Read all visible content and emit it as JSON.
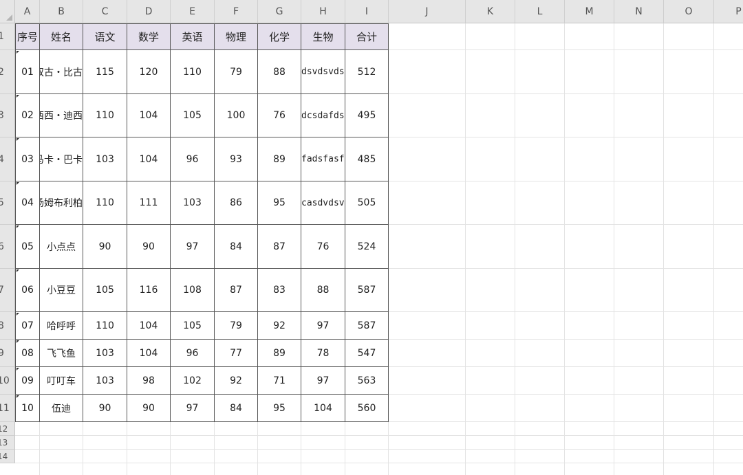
{
  "columns": [
    "A",
    "B",
    "C",
    "D",
    "E",
    "F",
    "G",
    "H",
    "I",
    "J",
    "K",
    "L",
    "M",
    "N",
    "O",
    "P"
  ],
  "row_numbers": [
    "1",
    "2",
    "3",
    "4",
    "5",
    "6",
    "7",
    "8",
    "9",
    "10",
    "11",
    "12",
    "13",
    "14"
  ],
  "table": {
    "headers": [
      "序号",
      "姓名",
      "语文",
      "数学",
      "英语",
      "物理",
      "化学",
      "生物",
      "合计"
    ],
    "rows": [
      [
        "01",
        "奴古・比古",
        "115",
        "120",
        "110",
        "79",
        "88",
        "dsvdsvdsv",
        "512"
      ],
      [
        "02",
        "西西・迪西",
        "110",
        "104",
        "105",
        "100",
        "76",
        "dcsdafdsf",
        "495"
      ],
      [
        "03",
        "马卡・巴卡",
        "103",
        "104",
        "96",
        "93",
        "89",
        "fadsfasfd",
        "485"
      ],
      [
        "04",
        "汤姆布利柏",
        "110",
        "111",
        "103",
        "86",
        "95",
        "casdvdsvs",
        "505"
      ],
      [
        "05",
        "小点点",
        "90",
        "90",
        "97",
        "84",
        "87",
        "76",
        "524"
      ],
      [
        "06",
        "小豆豆",
        "105",
        "116",
        "108",
        "87",
        "83",
        "88",
        "587"
      ],
      [
        "07",
        "哈呼呼",
        "110",
        "104",
        "105",
        "79",
        "92",
        "97",
        "587"
      ],
      [
        "08",
        "飞飞鱼",
        "103",
        "104",
        "96",
        "77",
        "89",
        "78",
        "547"
      ],
      [
        "09",
        "叮叮车",
        "103",
        "98",
        "102",
        "92",
        "71",
        "97",
        "563"
      ],
      [
        "10",
        "伍迪",
        "90",
        "90",
        "97",
        "84",
        "95",
        "104",
        "560"
      ]
    ]
  },
  "colors": {
    "header_fill": "#e4dfec",
    "grid": "#e3e3e3",
    "border": "#555555"
  },
  "icons": {
    "select_all": "select-all-triangle-icon"
  }
}
